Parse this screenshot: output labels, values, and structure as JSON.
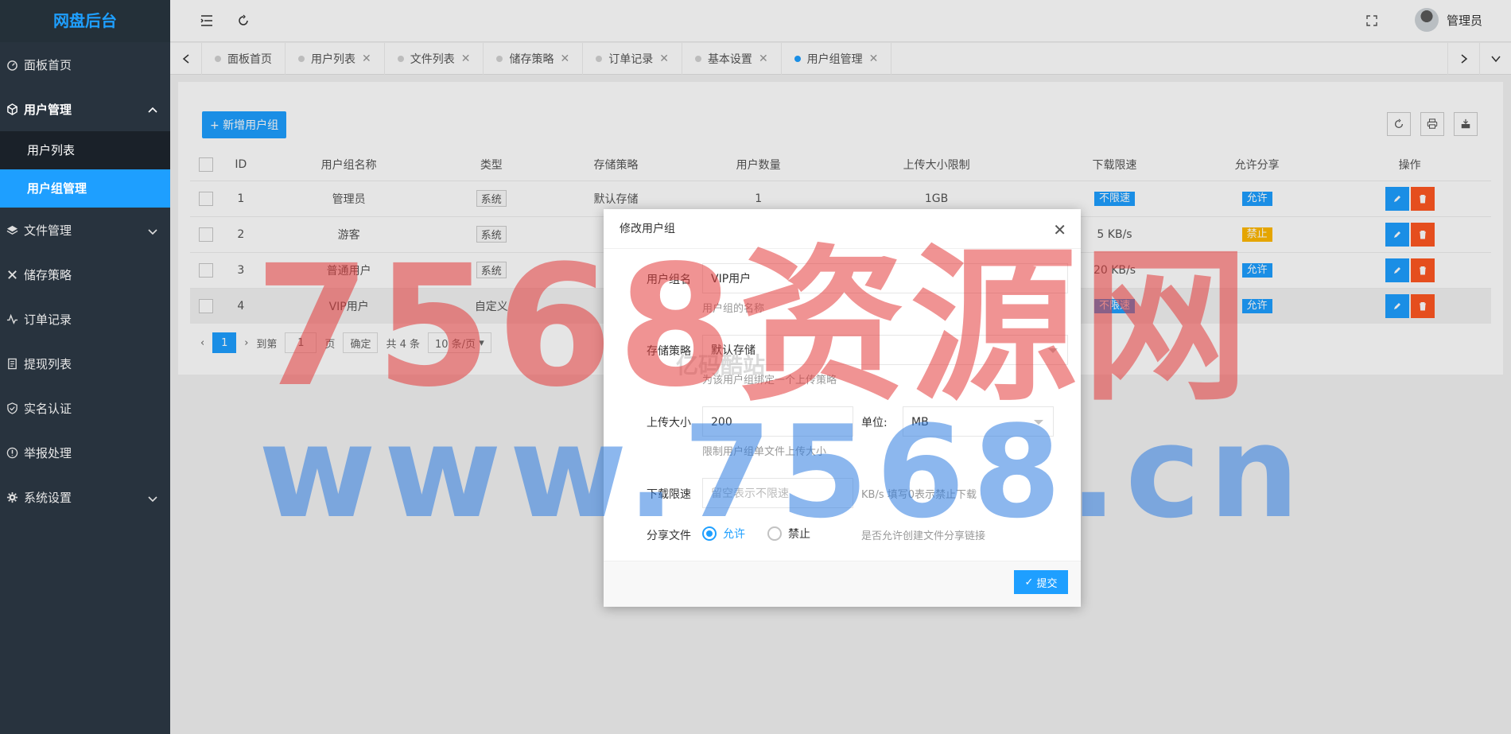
{
  "brand": {
    "title": "网盘后台"
  },
  "sidebar": {
    "items": [
      {
        "label": "面板首页",
        "icon": "dashboard-icon"
      },
      {
        "label": "用户管理",
        "icon": "cube-icon"
      },
      {
        "label": "文件管理",
        "icon": "layers-icon"
      },
      {
        "label": "储存策略",
        "icon": "tools-icon"
      },
      {
        "label": "订单记录",
        "icon": "activity-icon"
      },
      {
        "label": "提现列表",
        "icon": "list-icon"
      },
      {
        "label": "实名认证",
        "icon": "shield-icon"
      },
      {
        "label": "举报处理",
        "icon": "alert-icon"
      },
      {
        "label": "系统设置",
        "icon": "gear-icon"
      }
    ],
    "sub": [
      {
        "label": "用户列表"
      },
      {
        "label": "用户组管理"
      }
    ]
  },
  "header": {
    "user": "管理员"
  },
  "tabs": [
    {
      "label": "面板首页"
    },
    {
      "label": "用户列表"
    },
    {
      "label": "文件列表"
    },
    {
      "label": "储存策略"
    },
    {
      "label": "订单记录"
    },
    {
      "label": "基本设置"
    },
    {
      "label": "用户组管理"
    }
  ],
  "toolbar": {
    "add_label": "+ 新增用户组"
  },
  "table": {
    "headers": [
      "ID",
      "用户组名称",
      "类型",
      "存储策略",
      "用户数量",
      "上传大小限制",
      "下载限速",
      "允许分享",
      "操作"
    ],
    "rows": [
      {
        "id": "1",
        "name": "管理员",
        "type": "系统",
        "policy": "默认存储",
        "count": "1",
        "upload": "1GB",
        "speed": "不限速",
        "share": "允许"
      },
      {
        "id": "2",
        "name": "游客",
        "type": "系统",
        "policy": "",
        "count": "",
        "upload": "",
        "speed": "5 KB/s",
        "share": "禁止"
      },
      {
        "id": "3",
        "name": "普通用户",
        "type": "系统",
        "policy": "",
        "count": "",
        "upload": "",
        "speed": "20 KB/s",
        "share": "允许"
      },
      {
        "id": "4",
        "name": "VIP用户",
        "type": "自定义",
        "policy": "",
        "count": "",
        "upload": "",
        "speed": "不限速",
        "share": "允许"
      }
    ]
  },
  "pager": {
    "current": "1",
    "goto_label": "到第",
    "page_value": "1",
    "page_label": "页",
    "confirm": "确定",
    "total": "共 4 条",
    "per_page": "10 条/页"
  },
  "modal": {
    "title": "修改用户组",
    "name_label": "用户组名",
    "name_value": "VIP用户",
    "name_hint": "用户组的名称",
    "policy_label": "存储策略",
    "policy_value": "默认存储",
    "policy_hint": "为该用户组绑定一个上传策略",
    "upload_label": "上传大小",
    "upload_value": "200",
    "unit_label": "单位:",
    "unit_value": "MB",
    "upload_hint": "限制用户组单文件上传大小",
    "speed_label": "下载限速",
    "speed_placeholder": "留空表示不限速",
    "speed_hint": "KB/s 填写0表示禁止下载",
    "share_label": "分享文件",
    "allow": "允许",
    "deny": "禁止",
    "share_hint": "是否允许创建文件分享链接",
    "submit": "提交"
  },
  "watermark": {
    "line1": "7568资源网",
    "line2": "www.7568.cn",
    "logo": "亿码酷站"
  }
}
